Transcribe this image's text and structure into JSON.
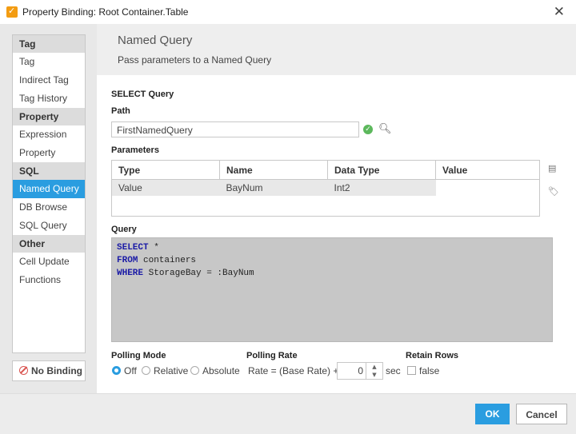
{
  "window": {
    "title": "Property Binding: Root Container.Table"
  },
  "nav": {
    "categories": [
      {
        "label": "Tag",
        "items": [
          "Tag",
          "Indirect Tag",
          "Tag History"
        ]
      },
      {
        "label": "Property",
        "items": [
          "Expression",
          "Property"
        ]
      },
      {
        "label": "SQL",
        "items": [
          "Named Query",
          "DB Browse",
          "SQL Query"
        ]
      },
      {
        "label": "Other",
        "items": [
          "Cell Update",
          "Functions"
        ]
      }
    ],
    "selected": "Named Query",
    "no_binding": "No Binding"
  },
  "header": {
    "title": "Named Query",
    "subtitle": "Pass parameters to a Named Query"
  },
  "form": {
    "section_label": "SELECT Query",
    "path_label": "Path",
    "path_value": "FirstNamedQuery",
    "parameters_label": "Parameters",
    "parameters": {
      "columns": [
        "Type",
        "Name",
        "Data Type",
        "Value"
      ],
      "rows": [
        [
          "Value",
          "BayNum",
          "Int2",
          ""
        ]
      ]
    },
    "query_label": "Query",
    "query_lines": [
      {
        "kw": "SELECT",
        "rest": " *"
      },
      {
        "kw": "FROM",
        "rest": " containers"
      },
      {
        "kw": "WHERE",
        "rest": " StorageBay = :BayNum"
      }
    ]
  },
  "polling": {
    "mode_label": "Polling Mode",
    "options": [
      "Off",
      "Relative",
      "Absolute"
    ],
    "selected": "Off",
    "rate_label": "Polling Rate",
    "rate_text": "Rate = (Base Rate) +/-",
    "rate_value": "0",
    "rate_unit": "sec",
    "retain_label": "Retain Rows",
    "retain_value": "false"
  },
  "buttons": {
    "ok": "OK",
    "cancel": "Cancel"
  },
  "colors": {
    "accent": "#2a9de0",
    "keyword": "#1a1aa6",
    "query_bg": "#c7c7c7"
  }
}
